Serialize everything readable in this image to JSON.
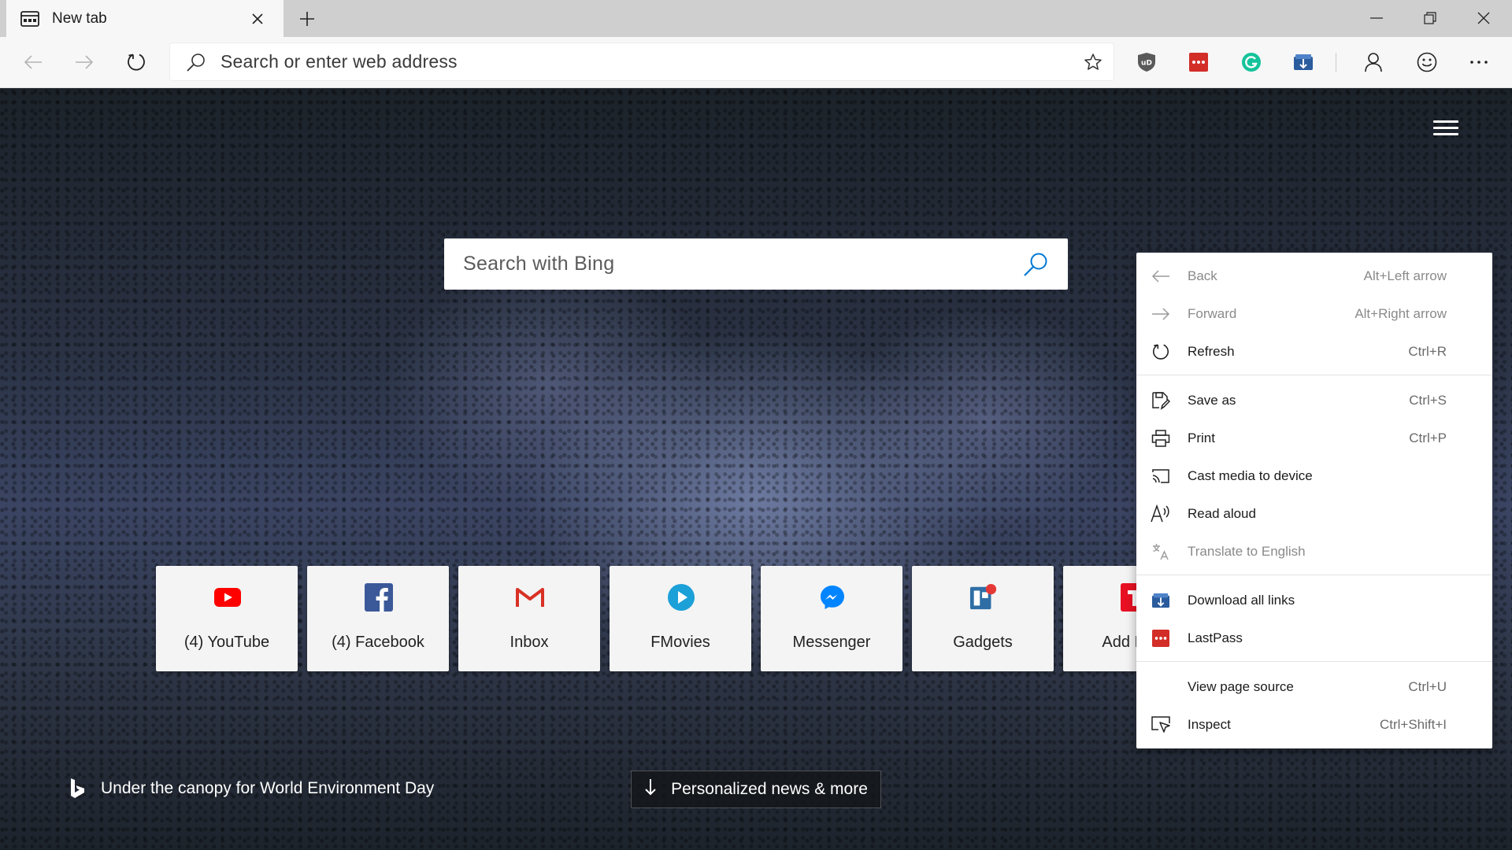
{
  "tab": {
    "title": "New tab",
    "close_icon": "close-icon"
  },
  "toolbar": {
    "address_placeholder": "Search or enter web address"
  },
  "page": {
    "search_placeholder": "Search with Bing",
    "tiles": [
      {
        "label": "(4) YouTube",
        "icon": "youtube-icon",
        "color": "#ff0000"
      },
      {
        "label": "(4) Facebook",
        "icon": "facebook-icon",
        "color": "#3b5998"
      },
      {
        "label": "Inbox",
        "icon": "gmail-icon",
        "color": "#d93025"
      },
      {
        "label": "FMovies",
        "icon": "fmovies-icon",
        "color": "#1ca0d8"
      },
      {
        "label": "Messenger",
        "icon": "messenger-icon",
        "color": "#0084ff"
      },
      {
        "label": "Gadgets",
        "icon": "gadgets-icon",
        "color": "#2f6ea5"
      },
      {
        "label": "Add New",
        "icon": "add-new-icon",
        "color": "#e81123"
      }
    ],
    "caption": "Under the canopy for World Environment Day",
    "news_button": "Personalized news & more"
  },
  "menu": {
    "items": [
      {
        "label": "Back",
        "shortcut": "Alt+Left arrow",
        "icon": "back-arrow-icon",
        "disabled": true
      },
      {
        "label": "Forward",
        "shortcut": "Alt+Right arrow",
        "icon": "forward-arrow-icon",
        "disabled": true
      },
      {
        "label": "Refresh",
        "shortcut": "Ctrl+R",
        "icon": "refresh-icon",
        "disabled": false
      },
      {
        "label": "Save as",
        "shortcut": "Ctrl+S",
        "icon": "save-as-icon",
        "disabled": false
      },
      {
        "label": "Print",
        "shortcut": "Ctrl+P",
        "icon": "print-icon",
        "disabled": false
      },
      {
        "label": "Cast media to device",
        "shortcut": "",
        "icon": "cast-icon",
        "disabled": false
      },
      {
        "label": "Read aloud",
        "shortcut": "",
        "icon": "read-aloud-icon",
        "disabled": false
      },
      {
        "label": "Translate to English",
        "shortcut": "",
        "icon": "translate-icon",
        "disabled": true
      },
      {
        "label": "Download all links",
        "shortcut": "",
        "icon": "download-links-icon",
        "disabled": false
      },
      {
        "label": "LastPass",
        "shortcut": "",
        "icon": "lastpass-icon",
        "disabled": false
      },
      {
        "label": "View page source",
        "shortcut": "Ctrl+U",
        "icon": "",
        "disabled": false
      },
      {
        "label": "Inspect",
        "shortcut": "Ctrl+Shift+I",
        "icon": "inspect-icon",
        "disabled": false
      }
    ]
  },
  "colors": {
    "accent": "#0078d4",
    "lastpass": "#d32d27",
    "grammarly": "#15c39a"
  }
}
